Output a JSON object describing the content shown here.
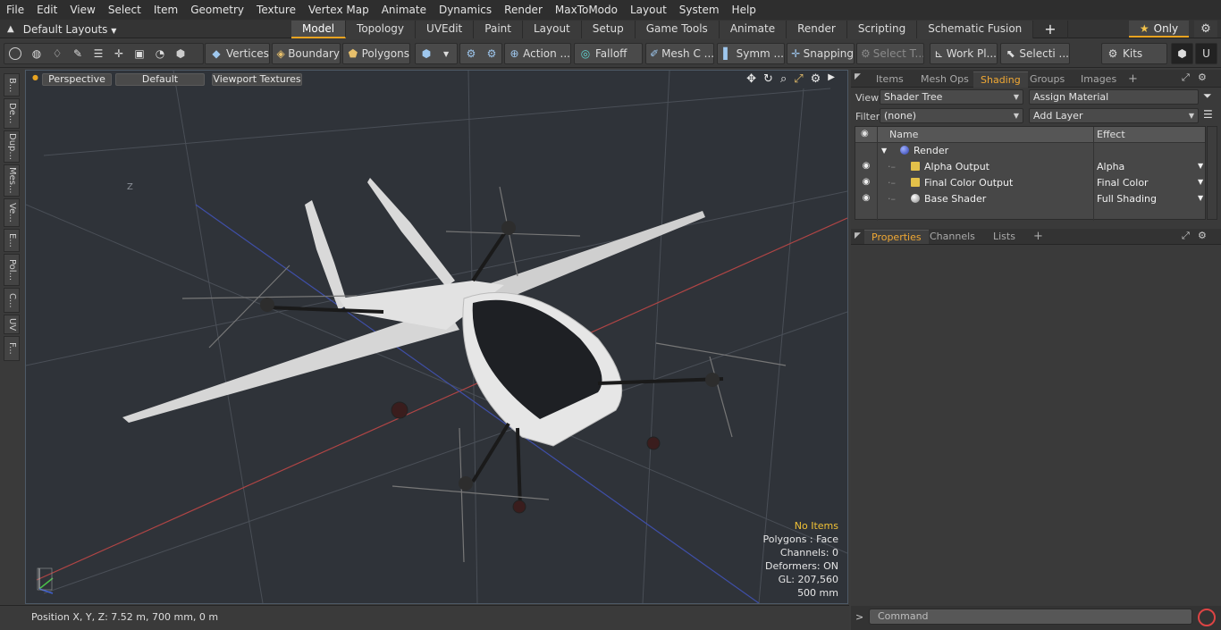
{
  "menu": [
    "File",
    "Edit",
    "View",
    "Select",
    "Item",
    "Geometry",
    "Texture",
    "Vertex Map",
    "Animate",
    "Dynamics",
    "Render",
    "MaxToModo",
    "Layout",
    "System",
    "Help"
  ],
  "layout": {
    "selector": "Default Layouts",
    "tabs": [
      "Model",
      "Topology",
      "UVEdit",
      "Paint",
      "Layout",
      "Setup",
      "Game Tools",
      "Animate",
      "Render",
      "Scripting",
      "Schematic Fusion"
    ],
    "active_tab": "Model",
    "only_label": "Only"
  },
  "toolbar": {
    "vertices": "Vertices",
    "boundary": "Boundary",
    "polygons": "Polygons",
    "action": "Action ...",
    "falloff": "Falloff",
    "mesh": "Mesh C ...",
    "symm": "Symm ...",
    "snapping": "Snapping",
    "select_t": "Select T...",
    "work_pl": "Work Pl...",
    "selecti": "Selecti ...",
    "kits": "Kits"
  },
  "viewport": {
    "perspective": "Perspective",
    "default": "Default",
    "textures": "Viewport Textures",
    "axis_label": "Z",
    "stats": {
      "no_items": "No Items",
      "polygons": "Polygons : Face",
      "channels": "Channels: 0",
      "deformers": "Deformers: ON",
      "gl": "GL: 207,560",
      "scale": "500 mm"
    }
  },
  "side_tabs": [
    "B...",
    "De...",
    "Dup...",
    "Mes...",
    "Ve...",
    "E...",
    "Pol...",
    "C...",
    "UV",
    "F..."
  ],
  "status": {
    "position": "Position X, Y, Z:   7.52 m, 700 mm, 0 m"
  },
  "right_panel": {
    "tabs": [
      "Items",
      "Mesh Ops",
      "Shading",
      "Groups",
      "Images"
    ],
    "active_tab": "Shading",
    "view_label": "View",
    "view_value": "Shader Tree",
    "assign": "Assign Material",
    "filter_label": "Filter",
    "filter_value": "(none)",
    "add_layer": "Add Layer",
    "col_name": "Name",
    "col_effect": "Effect",
    "rows": [
      {
        "name": "Render",
        "effect": ""
      },
      {
        "name": "Alpha Output",
        "effect": "Alpha"
      },
      {
        "name": "Final Color Output",
        "effect": "Final Color"
      },
      {
        "name": "Base Shader",
        "effect": "Full Shading"
      }
    ],
    "props_tabs": [
      "Properties",
      "Channels",
      "Lists"
    ],
    "command_placeholder": "Command"
  },
  "colors": {
    "accent": "#e8a321",
    "stat_highlight": "#f1c236",
    "viewport_bg": "#2f3339"
  }
}
